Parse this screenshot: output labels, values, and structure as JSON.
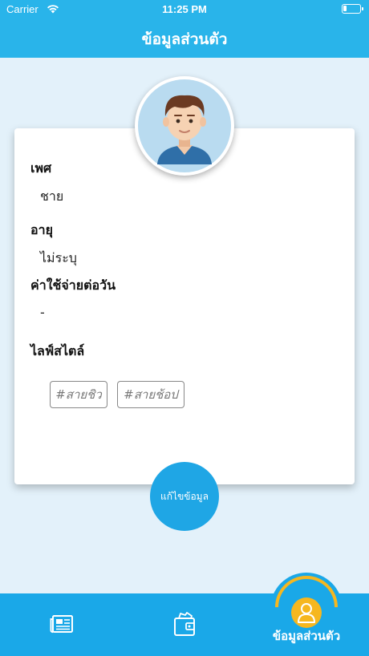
{
  "status_bar": {
    "carrier": "Carrier",
    "time": "11:25 PM"
  },
  "header": {
    "title": "ข้อมูลส่วนตัว"
  },
  "profile": {
    "fields": [
      {
        "label": "เพศ",
        "value": "ชาย"
      },
      {
        "label": "อายุ",
        "value": "ไม่ระบุ"
      },
      {
        "label": "ค่าใช้จ่ายต่อวัน",
        "value": "-"
      }
    ],
    "lifestyle_label": "ไลฟ์สไตล์",
    "tags": [
      "#สายชิว",
      "#สายช้อป"
    ],
    "edit_button_label": "แก้ไขข้อมูล"
  },
  "tabs": {
    "active_label": "ข้อมูลส่วนตัว",
    "items": [
      "news-icon",
      "wallet-icon",
      "profile-icon"
    ]
  },
  "colors": {
    "primary": "#29b4ea",
    "tabbar": "#1aa8e8",
    "accent": "#f6b71f",
    "background": "#e3f1fa"
  }
}
